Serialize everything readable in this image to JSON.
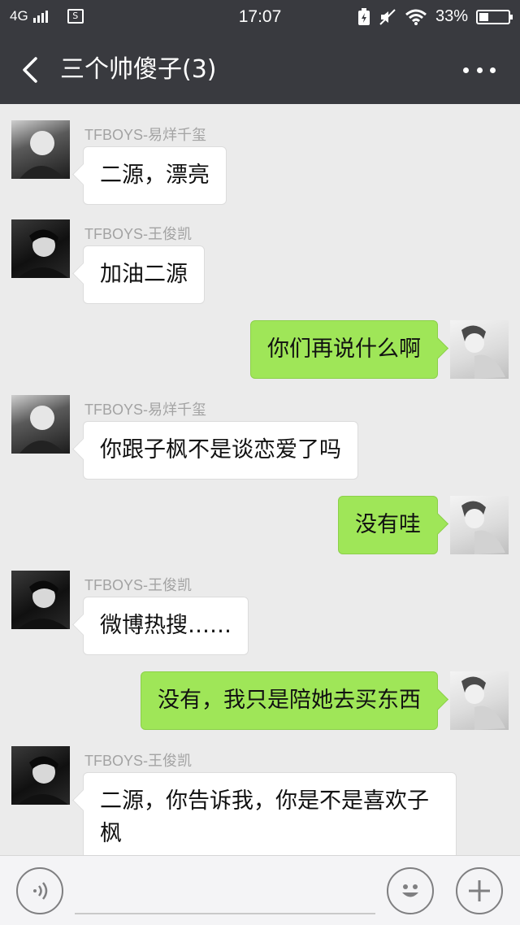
{
  "status_bar": {
    "network": "4G",
    "sim_icon_label": "S",
    "time": "17:07",
    "battery_percent": "33%",
    "battery_level": 0.33,
    "icons": [
      "signal-icon",
      "sim-icon",
      "battery-saver-icon",
      "mute-icon",
      "wifi-icon",
      "battery-icon"
    ]
  },
  "header": {
    "title": "三个帅傻子(3)",
    "back_icon": "chevron-left-icon",
    "more_icon": "more-dots-icon"
  },
  "messages": [
    {
      "side": "left",
      "sender": "TFBOYS-易烊千玺",
      "text": "二源，漂亮"
    },
    {
      "side": "left",
      "sender": "TFBOYS-王俊凯",
      "text": "加油二源"
    },
    {
      "side": "right",
      "text": "你们再说什么啊"
    },
    {
      "side": "left",
      "sender": "TFBOYS-易烊千玺",
      "text": "你跟子枫不是谈恋爱了吗"
    },
    {
      "side": "right",
      "text": "没有哇"
    },
    {
      "side": "left",
      "sender": "TFBOYS-王俊凯",
      "text": "微博热搜……"
    },
    {
      "side": "right",
      "text": "没有，我只是陪她去买东西"
    },
    {
      "side": "left",
      "sender": "TFBOYS-王俊凯",
      "text": "二源，你告诉我，你是不是喜欢子枫"
    }
  ],
  "input_bar": {
    "voice_icon": "voice-icon",
    "emoji_icon": "emoji-icon",
    "plus_icon": "plus-icon"
  }
}
